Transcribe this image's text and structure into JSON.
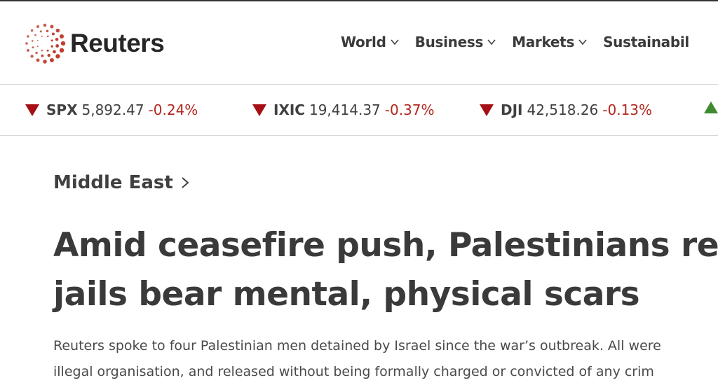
{
  "brand": {
    "name": "Reuters",
    "logo_icon": "reuters-dot-ring-logo",
    "accent_color": "#c0392b"
  },
  "nav": {
    "items": [
      {
        "label": "World",
        "icon": "chevron-down-icon"
      },
      {
        "label": "Business",
        "icon": "chevron-down-icon"
      },
      {
        "label": "Markets",
        "icon": "chevron-down-icon"
      },
      {
        "label": "Sustainabil"
      }
    ]
  },
  "ticker": {
    "items": [
      {
        "symbol": "SPX",
        "value": "5,892.47",
        "change": "-0.24%",
        "direction": "down"
      },
      {
        "symbol": "IXIC",
        "value": "19,414.37",
        "change": "-0.37%",
        "direction": "down"
      },
      {
        "symbol": "DJI",
        "value": "42,518.26",
        "change": "-0.13%",
        "direction": "down"
      },
      {
        "direction": "up"
      }
    ],
    "colors": {
      "down": "#a50f15",
      "up": "#3e8a2f",
      "negative_text": "#b3261e"
    }
  },
  "article": {
    "section": "Middle East",
    "section_icon": "chevron-right-icon",
    "headline_lines": [
      "Amid ceasefire push, Palestinians rele",
      "jails bear mental, physical scars"
    ],
    "summary_lines": [
      "Reuters spoke to four Palestinian men detained by Israel since the war’s outbreak. All were",
      "illegal organisation, and released without being formally charged or convicted of any crim"
    ]
  }
}
